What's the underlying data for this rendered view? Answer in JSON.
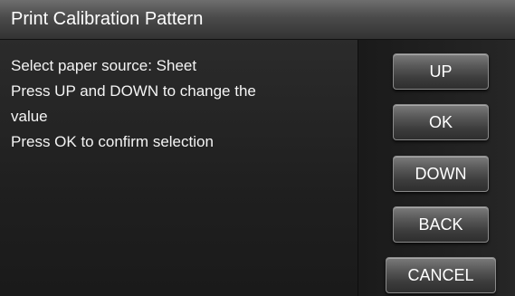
{
  "title": "Print Calibration Pattern",
  "message": {
    "lines": [
      "Select paper source: Sheet",
      "Press UP and DOWN to change the",
      "value",
      "Press OK to confirm selection"
    ]
  },
  "buttons": {
    "up": "UP",
    "ok": "OK",
    "down": "DOWN",
    "back": "BACK",
    "cancel": "CANCEL"
  }
}
